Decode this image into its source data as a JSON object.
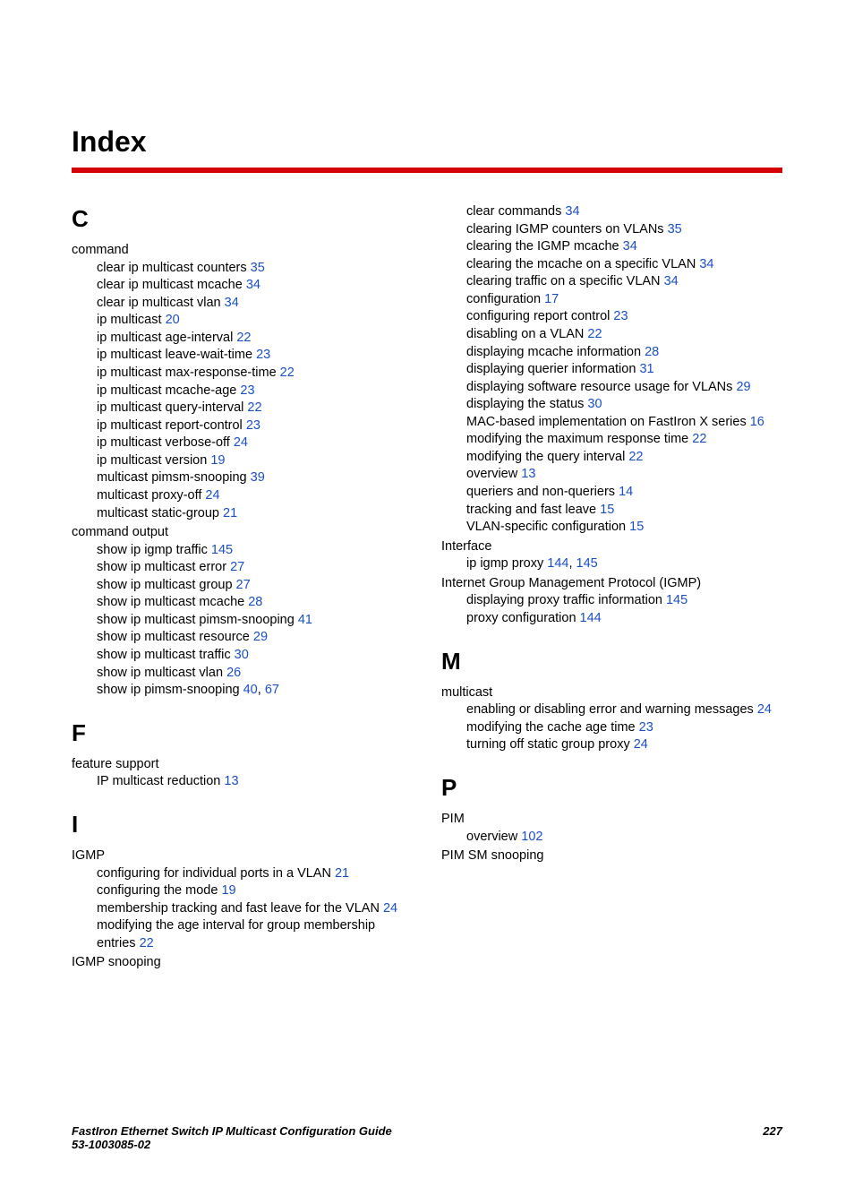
{
  "title": "Index",
  "sections_left": [
    {
      "letter": "C",
      "groups": [
        {
          "term": "command",
          "subs": [
            {
              "text": "clear ip multicast counters ",
              "refs": [
                "35"
              ]
            },
            {
              "text": "clear ip multicast mcache ",
              "refs": [
                "34"
              ]
            },
            {
              "text": "clear ip multicast vlan ",
              "refs": [
                "34"
              ]
            },
            {
              "text": "ip multicast ",
              "refs": [
                "20"
              ]
            },
            {
              "text": "ip multicast age-interval ",
              "refs": [
                "22"
              ]
            },
            {
              "text": "ip multicast leave-wait-time ",
              "refs": [
                "23"
              ]
            },
            {
              "text": "ip multicast max-response-time ",
              "refs": [
                "22"
              ]
            },
            {
              "text": "ip multicast mcache-age ",
              "refs": [
                "23"
              ]
            },
            {
              "text": "ip multicast query-interval ",
              "refs": [
                "22"
              ]
            },
            {
              "text": "ip multicast report-control ",
              "refs": [
                "23"
              ]
            },
            {
              "text": "ip multicast verbose-off ",
              "refs": [
                "24"
              ]
            },
            {
              "text": "ip multicast version ",
              "refs": [
                "19"
              ]
            },
            {
              "text": "multicast pimsm-snooping ",
              "refs": [
                "39"
              ]
            },
            {
              "text": "multicast proxy-off ",
              "refs": [
                "24"
              ]
            },
            {
              "text": "multicast static-group ",
              "refs": [
                "21"
              ]
            }
          ]
        },
        {
          "term": "command output",
          "subs": [
            {
              "text": "show ip igmp traffic ",
              "refs": [
                "145"
              ]
            },
            {
              "text": "show ip multicast error ",
              "refs": [
                "27"
              ]
            },
            {
              "text": "show ip multicast group ",
              "refs": [
                "27"
              ]
            },
            {
              "text": "show ip multicast mcache ",
              "refs": [
                "28"
              ]
            },
            {
              "text": "show ip multicast pimsm-snooping ",
              "refs": [
                "41"
              ]
            },
            {
              "text": "show ip multicast resource ",
              "refs": [
                "29"
              ]
            },
            {
              "text": "show ip multicast traffic ",
              "refs": [
                "30"
              ]
            },
            {
              "text": "show ip multicast vlan ",
              "refs": [
                "26"
              ]
            },
            {
              "text": "show ip pimsm-snooping ",
              "refs": [
                "40",
                "67"
              ]
            }
          ]
        }
      ]
    },
    {
      "letter": "F",
      "groups": [
        {
          "term": "feature support",
          "subs": [
            {
              "text": "IP multicast reduction ",
              "refs": [
                "13"
              ]
            }
          ]
        }
      ]
    },
    {
      "letter": "I",
      "groups": [
        {
          "term": "IGMP",
          "subs": [
            {
              "text": "configuring for individual ports in a VLAN ",
              "refs": [
                "21"
              ]
            },
            {
              "text": "configuring the mode ",
              "refs": [
                "19"
              ]
            },
            {
              "text": "membership tracking and fast leave for the VLAN ",
              "refs": [
                "24"
              ]
            },
            {
              "text": "modifying the age interval for group membership entries ",
              "refs": [
                "22"
              ]
            }
          ]
        },
        {
          "term": "IGMP snooping",
          "subs": []
        }
      ]
    }
  ],
  "sections_right": [
    {
      "letter": "",
      "groups": [
        {
          "term": "",
          "subs": [
            {
              "text": "clear commands ",
              "refs": [
                "34"
              ]
            },
            {
              "text": "clearing IGMP counters on VLANs ",
              "refs": [
                "35"
              ]
            },
            {
              "text": "clearing the IGMP mcache ",
              "refs": [
                "34"
              ]
            },
            {
              "text": "clearing the mcache on a specific VLAN ",
              "refs": [
                "34"
              ]
            },
            {
              "text": "clearing traffic on a specific VLAN ",
              "refs": [
                "34"
              ]
            },
            {
              "text": "configuration ",
              "refs": [
                "17"
              ]
            },
            {
              "text": "configuring report control ",
              "refs": [
                "23"
              ]
            },
            {
              "text": "disabling on a VLAN ",
              "refs": [
                "22"
              ]
            },
            {
              "text": "displaying mcache information ",
              "refs": [
                "28"
              ]
            },
            {
              "text": "displaying querier information ",
              "refs": [
                "31"
              ]
            },
            {
              "text": "displaying software resource usage for VLANs ",
              "refs": [
                "29"
              ]
            },
            {
              "text": "displaying the status ",
              "refs": [
                "30"
              ]
            },
            {
              "text": "MAC-based implementation on FastIron X series ",
              "refs": [
                "16"
              ]
            },
            {
              "text": "modifying the maximum response time ",
              "refs": [
                "22"
              ]
            },
            {
              "text": "modifying the query interval ",
              "refs": [
                "22"
              ]
            },
            {
              "text": "overview ",
              "refs": [
                "13"
              ]
            },
            {
              "text": "queriers and non-queriers ",
              "refs": [
                "14"
              ]
            },
            {
              "text": "tracking and fast leave ",
              "refs": [
                "15"
              ]
            },
            {
              "text": "VLAN-specific configuration ",
              "refs": [
                "15"
              ]
            }
          ]
        },
        {
          "term": "Interface",
          "subs": [
            {
              "text": "ip igmp proxy ",
              "refs": [
                "144",
                "145"
              ]
            }
          ]
        },
        {
          "term": "Internet Group Management Protocol (IGMP)",
          "subs": [
            {
              "text": "displaying proxy traffic information ",
              "refs": [
                "145"
              ]
            },
            {
              "text": "proxy configuration ",
              "refs": [
                "144"
              ]
            }
          ]
        }
      ]
    },
    {
      "letter": "M",
      "groups": [
        {
          "term": "multicast",
          "subs": [
            {
              "text": "enabling or disabling error and warning messages ",
              "refs": [
                "24"
              ]
            },
            {
              "text": "modifying the cache age time ",
              "refs": [
                "23"
              ]
            },
            {
              "text": "turning off static group proxy ",
              "refs": [
                "24"
              ]
            }
          ]
        }
      ]
    },
    {
      "letter": "P",
      "groups": [
        {
          "term": "PIM",
          "subs": [
            {
              "text": "overview ",
              "refs": [
                "102"
              ]
            }
          ]
        },
        {
          "term": "PIM SM snooping",
          "subs": []
        }
      ]
    }
  ],
  "footer": {
    "line1": "FastIron Ethernet Switch IP Multicast Configuration Guide",
    "line2": "53-1003085-02",
    "page": "227"
  }
}
